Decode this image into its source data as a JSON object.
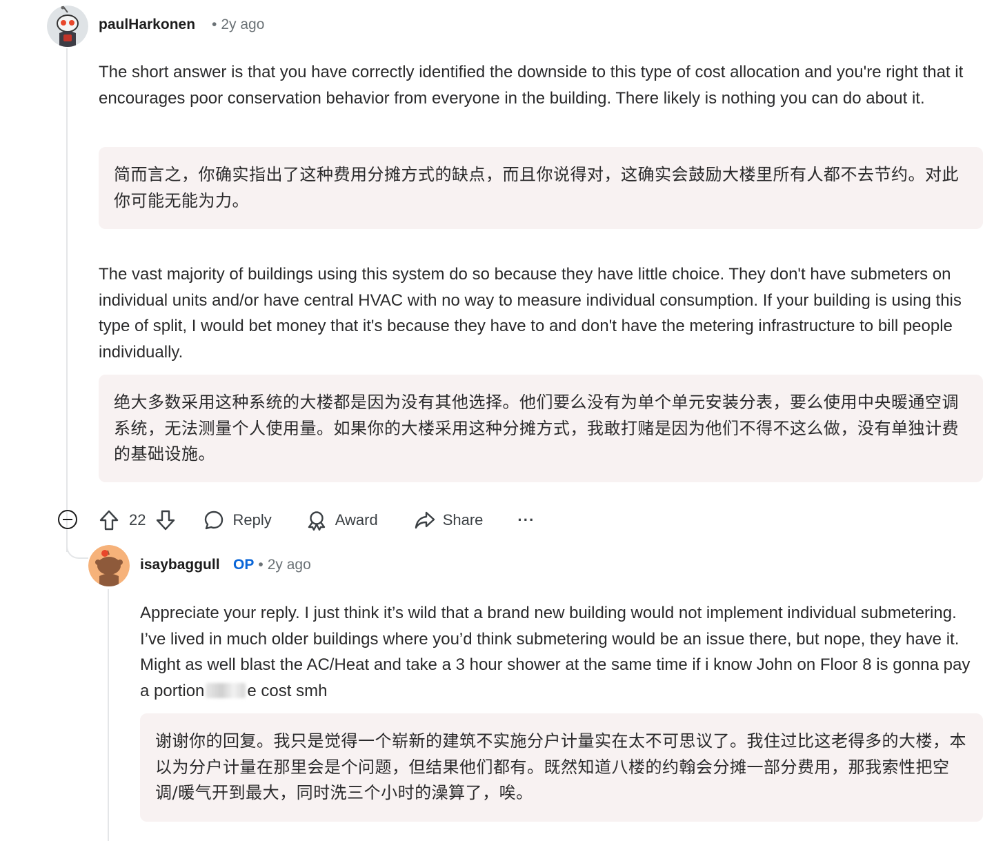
{
  "comment1": {
    "username": "paulHarkonen",
    "time": "2y ago",
    "paragraphs": [
      {
        "en": "The short answer is that you have correctly identified the downside to this type of cost allocation and you're right that it encourages poor conservation behavior from everyone in the building. There likely is nothing you can do about it.",
        "zh": "简而言之，你确实指出了这种费用分摊方式的缺点，而且你说得对，这确实会鼓励大楼里所有人都不去节约。对此你可能无能为力。"
      },
      {
        "en": "The vast majority of buildings using this system do so because they have little choice. They don't have submeters on individual units and/or have central HVAC with no way to measure individual consumption. If your building is using this type of split, I would bet money that it's because they have to and don't have the metering infrastructure to bill people individually.",
        "zh": "绝大多数采用这种系统的大楼都是因为没有其他选择。他们要么没有为单个单元安装分表，要么使用中央暖通空调系统，无法测量个人使用量。如果你的大楼采用这种分摊方式，我敢打赌是因为他们不得不这么做，没有单独计费的基础设施。"
      }
    ],
    "votes": "22",
    "reply_label": "Reply",
    "award_label": "Award",
    "share_label": "Share",
    "more_label": "···"
  },
  "comment2": {
    "username": "isaybaggull",
    "op_tag": "OP",
    "time": "2y ago",
    "en_part1": "Appreciate your reply. I just think it’s wild that a brand new building would not implement individual submetering. I’ve lived in much older buildings where you’d think submetering would be an issue there, but nope, they have it. Might as well blast the AC/Heat and take a 3 hour shower at the same time if i know John on Floor 8 is gonna pay a portion",
    "en_part2": "e cost smh",
    "zh": "谢谢你的回复。我只是觉得一个崭新的建筑不实施分户计量实在太不可思议了。我住过比这老得多的大楼，本以为分户计量在那里会是个问题，但结果他们都有。既然知道八楼的约翰会分摊一部分费用，那我索性把空调/暖气开到最大，同时洗三个小时的澡算了，唉。"
  }
}
